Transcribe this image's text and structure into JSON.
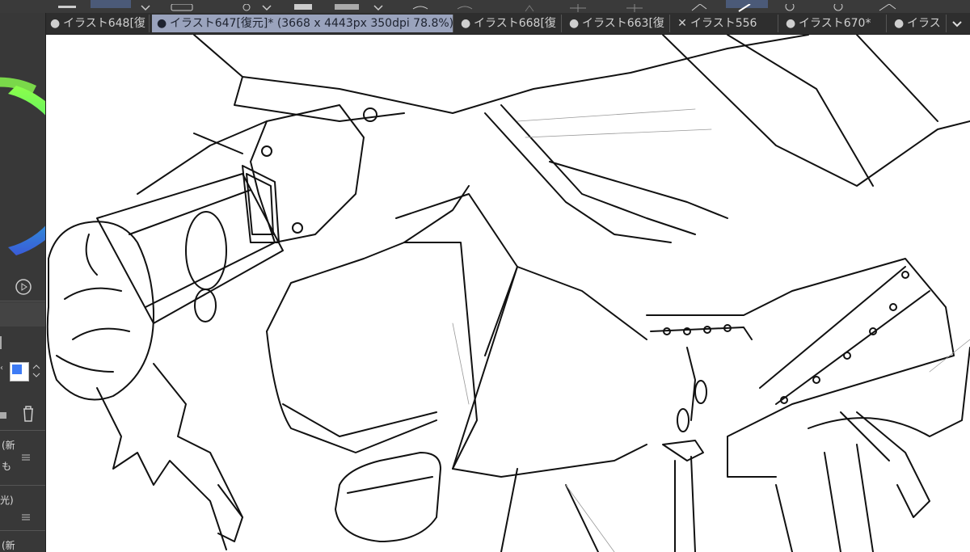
{
  "app": {
    "tabs": [
      {
        "label": "イラスト648[復",
        "state": "dot",
        "active": false
      },
      {
        "label": "イラスト647[復元]* (3668 x 4443px 350dpi 78.8%)",
        "state": "dot",
        "active": true
      },
      {
        "label": "イラスト668[復",
        "state": "dot",
        "active": false
      },
      {
        "label": "イラスト663[復",
        "state": "dot",
        "active": false
      },
      {
        "label": "イラスト556",
        "state": "close",
        "active": false
      },
      {
        "label": "イラスト670*",
        "state": "dot",
        "active": false
      },
      {
        "label": "イラス",
        "state": "dot",
        "active": false
      }
    ],
    "overflow_icon": "chevron-down-icon"
  },
  "left_panel": {
    "layer_labels": [
      "(新",
      "も",
      "光)",
      "(新"
    ]
  },
  "colors": {
    "accent": "#3d7bf5",
    "tab_active_bg": "#9aa3bd",
    "panel_bg": "#383838",
    "canvas_bg": "#ffffff"
  }
}
